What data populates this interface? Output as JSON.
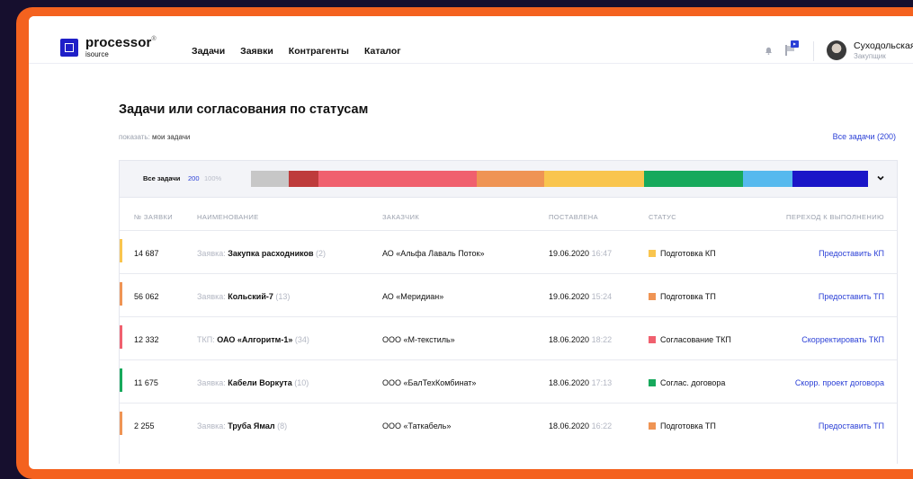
{
  "brand": {
    "name": "processor",
    "sup": "®",
    "sub": "isource"
  },
  "nav": [
    "Задачи",
    "Заявки",
    "Контрагенты",
    "Каталог"
  ],
  "user": {
    "name": "Суходольская",
    "role": "Закупщик"
  },
  "page": {
    "title": "Задачи или согласования по статусам",
    "show_label": "показать:",
    "show_value": "мои задачи",
    "all_link": "Все задачи (200)"
  },
  "status_header": {
    "label": "Все задачи",
    "count": "200",
    "percent": "100%",
    "segments": [
      {
        "share": 0.19,
        "color": "#c7c7c7"
      },
      {
        "share": 0.15,
        "color": "#be3b3b"
      },
      {
        "share": 0.8,
        "color": "#f0606e"
      },
      {
        "share": 0.34,
        "color": "#ef9454"
      },
      {
        "share": 0.5,
        "color": "#f9c54e"
      },
      {
        "share": 0.5,
        "color": "#17a95c"
      },
      {
        "share": 0.25,
        "color": "#56b9ee"
      },
      {
        "share": 0.38,
        "color": "#1a16c8"
      }
    ]
  },
  "columns": [
    "№ ЗАЯВКИ",
    "НАИМЕНОВАНИЕ",
    "ЗАКАЗЧИК",
    "ПОСТАВЛЕНА",
    "СТАТУС",
    "ПЕРЕХОД К ВЫПОЛНЕНИЮ"
  ],
  "rows": [
    {
      "number": "14 687",
      "prefix": "Заявка:",
      "name": "Закупка расходников",
      "count": "(2)",
      "customer": "АО «Альфа Лаваль Поток»",
      "date": "19.06.2020",
      "time": "16:47",
      "status": "Подготовка КП",
      "status_color": "#f9c54e",
      "accent": "#f9c54e",
      "action": "Предоставить КП"
    },
    {
      "number": "56 062",
      "prefix": "Заявка:",
      "name": "Кольский-7",
      "count": "(13)",
      "customer": "АО «Меридиан»",
      "date": "19.06.2020",
      "time": "15:24",
      "status": "Подготовка ТП",
      "status_color": "#ef9454",
      "accent": "#ef9454",
      "action": "Предоставить ТП"
    },
    {
      "number": "12 332",
      "prefix": "ТКП:",
      "name": "ОАО «Алгоритм-1»",
      "count": "(34)",
      "customer": "ООО «М-текстиль»",
      "date": "18.06.2020",
      "time": "18:22",
      "status": "Согласование ТКП",
      "status_color": "#f0606e",
      "accent": "#f0606e",
      "action": "Скорректировать ТКП"
    },
    {
      "number": "11 675",
      "prefix": "Заявка:",
      "name": "Кабели Воркута",
      "count": "(10)",
      "customer": "ООО «БалТехКомбинат»",
      "date": "18.06.2020",
      "time": "17:13",
      "status": "Соглас. договора",
      "status_color": "#17a95c",
      "accent": "#17a95c",
      "action": "Скорр. проект договора"
    },
    {
      "number": "2 255",
      "prefix": "Заявка:",
      "name": "Труба Ямал",
      "count": "(8)",
      "customer": "ООО «Таткабель»",
      "date": "18.06.2020",
      "time": "16:22",
      "status": "Подготовка ТП",
      "status_color": "#ef9454",
      "accent": "#ef9454",
      "action": "Предоставить ТП"
    }
  ],
  "icons": {
    "bell": "bell-icon",
    "flag": "message-flag-icon",
    "chevron": "chevron-down-icon"
  }
}
